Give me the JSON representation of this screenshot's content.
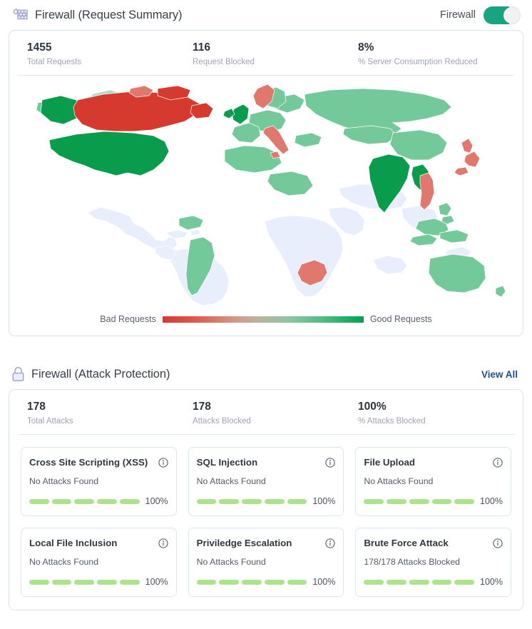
{
  "request_summary": {
    "icon": "firewall-icon",
    "title": "Firewall (Request Summary)",
    "toggle_label": "Firewall",
    "toggle_state": "on",
    "stats": [
      {
        "value": "1455",
        "label": "Total Requests"
      },
      {
        "value": "116",
        "label": "Request Blocked"
      },
      {
        "value": "8%",
        "label": "% Server Consumption Reduced"
      }
    ],
    "legend": {
      "left_label": "Bad Requests",
      "right_label": "Good Requests",
      "gradient_from": "#d6392e",
      "gradient_to": "#00a14f"
    },
    "map": {
      "default_fill": "#e8eefb",
      "colors": {
        "bad_strong": "#d6392e",
        "bad_light": "#e0786e",
        "good_strong": "#0a9c4d",
        "good_mid": "#74c99a",
        "good_light": "#a9dcc0"
      }
    }
  },
  "attack_protection": {
    "icon": "lock-icon",
    "title": "Firewall (Attack Protection)",
    "view_all_label": "View All",
    "stats": [
      {
        "value": "178",
        "label": "Total Attacks"
      },
      {
        "value": "178",
        "label": "Attacks Blocked"
      },
      {
        "value": "100%",
        "label": "% Attacks Blocked"
      }
    ],
    "cards": [
      {
        "name": "Cross Site Scripting (XSS)",
        "status": "No Attacks Found",
        "percent": "100%",
        "filled": 5
      },
      {
        "name": "SQL Injection",
        "status": "No Attacks Found",
        "percent": "100%",
        "filled": 5
      },
      {
        "name": "File Upload",
        "status": "No Attacks Found",
        "percent": "100%",
        "filled": 5
      },
      {
        "name": "Local File Inclusion",
        "status": "No Attacks Found",
        "percent": "100%",
        "filled": 5
      },
      {
        "name": "Priviledge Escalation",
        "status": "No Attacks Found",
        "percent": "100%",
        "filled": 5
      },
      {
        "name": "Brute Force Attack",
        "status": "178/178 Attacks Blocked",
        "percent": "100%",
        "filled": 5
      }
    ]
  }
}
